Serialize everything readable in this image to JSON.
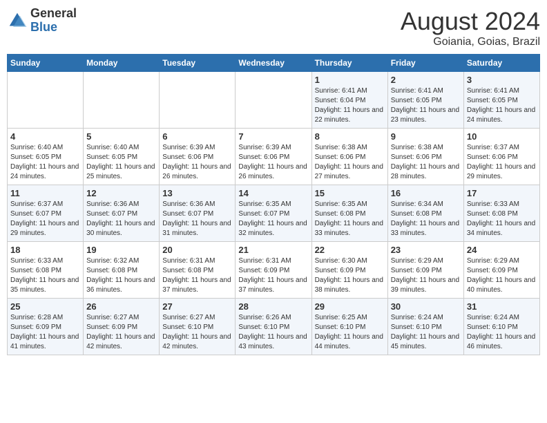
{
  "header": {
    "logo_general": "General",
    "logo_blue": "Blue",
    "month_year": "August 2024",
    "location": "Goiania, Goias, Brazil"
  },
  "days_of_week": [
    "Sunday",
    "Monday",
    "Tuesday",
    "Wednesday",
    "Thursday",
    "Friday",
    "Saturday"
  ],
  "weeks": [
    [
      {
        "day": "",
        "text": ""
      },
      {
        "day": "",
        "text": ""
      },
      {
        "day": "",
        "text": ""
      },
      {
        "day": "",
        "text": ""
      },
      {
        "day": "1",
        "text": "Sunrise: 6:41 AM\nSunset: 6:04 PM\nDaylight: 11 hours and 22 minutes."
      },
      {
        "day": "2",
        "text": "Sunrise: 6:41 AM\nSunset: 6:05 PM\nDaylight: 11 hours and 23 minutes."
      },
      {
        "day": "3",
        "text": "Sunrise: 6:41 AM\nSunset: 6:05 PM\nDaylight: 11 hours and 24 minutes."
      }
    ],
    [
      {
        "day": "4",
        "text": "Sunrise: 6:40 AM\nSunset: 6:05 PM\nDaylight: 11 hours and 24 minutes."
      },
      {
        "day": "5",
        "text": "Sunrise: 6:40 AM\nSunset: 6:05 PM\nDaylight: 11 hours and 25 minutes."
      },
      {
        "day": "6",
        "text": "Sunrise: 6:39 AM\nSunset: 6:06 PM\nDaylight: 11 hours and 26 minutes."
      },
      {
        "day": "7",
        "text": "Sunrise: 6:39 AM\nSunset: 6:06 PM\nDaylight: 11 hours and 26 minutes."
      },
      {
        "day": "8",
        "text": "Sunrise: 6:38 AM\nSunset: 6:06 PM\nDaylight: 11 hours and 27 minutes."
      },
      {
        "day": "9",
        "text": "Sunrise: 6:38 AM\nSunset: 6:06 PM\nDaylight: 11 hours and 28 minutes."
      },
      {
        "day": "10",
        "text": "Sunrise: 6:37 AM\nSunset: 6:06 PM\nDaylight: 11 hours and 29 minutes."
      }
    ],
    [
      {
        "day": "11",
        "text": "Sunrise: 6:37 AM\nSunset: 6:07 PM\nDaylight: 11 hours and 29 minutes."
      },
      {
        "day": "12",
        "text": "Sunrise: 6:36 AM\nSunset: 6:07 PM\nDaylight: 11 hours and 30 minutes."
      },
      {
        "day": "13",
        "text": "Sunrise: 6:36 AM\nSunset: 6:07 PM\nDaylight: 11 hours and 31 minutes."
      },
      {
        "day": "14",
        "text": "Sunrise: 6:35 AM\nSunset: 6:07 PM\nDaylight: 11 hours and 32 minutes."
      },
      {
        "day": "15",
        "text": "Sunrise: 6:35 AM\nSunset: 6:08 PM\nDaylight: 11 hours and 33 minutes."
      },
      {
        "day": "16",
        "text": "Sunrise: 6:34 AM\nSunset: 6:08 PM\nDaylight: 11 hours and 33 minutes."
      },
      {
        "day": "17",
        "text": "Sunrise: 6:33 AM\nSunset: 6:08 PM\nDaylight: 11 hours and 34 minutes."
      }
    ],
    [
      {
        "day": "18",
        "text": "Sunrise: 6:33 AM\nSunset: 6:08 PM\nDaylight: 11 hours and 35 minutes."
      },
      {
        "day": "19",
        "text": "Sunrise: 6:32 AM\nSunset: 6:08 PM\nDaylight: 11 hours and 36 minutes."
      },
      {
        "day": "20",
        "text": "Sunrise: 6:31 AM\nSunset: 6:08 PM\nDaylight: 11 hours and 37 minutes."
      },
      {
        "day": "21",
        "text": "Sunrise: 6:31 AM\nSunset: 6:09 PM\nDaylight: 11 hours and 37 minutes."
      },
      {
        "day": "22",
        "text": "Sunrise: 6:30 AM\nSunset: 6:09 PM\nDaylight: 11 hours and 38 minutes."
      },
      {
        "day": "23",
        "text": "Sunrise: 6:29 AM\nSunset: 6:09 PM\nDaylight: 11 hours and 39 minutes."
      },
      {
        "day": "24",
        "text": "Sunrise: 6:29 AM\nSunset: 6:09 PM\nDaylight: 11 hours and 40 minutes."
      }
    ],
    [
      {
        "day": "25",
        "text": "Sunrise: 6:28 AM\nSunset: 6:09 PM\nDaylight: 11 hours and 41 minutes."
      },
      {
        "day": "26",
        "text": "Sunrise: 6:27 AM\nSunset: 6:09 PM\nDaylight: 11 hours and 42 minutes."
      },
      {
        "day": "27",
        "text": "Sunrise: 6:27 AM\nSunset: 6:10 PM\nDaylight: 11 hours and 42 minutes."
      },
      {
        "day": "28",
        "text": "Sunrise: 6:26 AM\nSunset: 6:10 PM\nDaylight: 11 hours and 43 minutes."
      },
      {
        "day": "29",
        "text": "Sunrise: 6:25 AM\nSunset: 6:10 PM\nDaylight: 11 hours and 44 minutes."
      },
      {
        "day": "30",
        "text": "Sunrise: 6:24 AM\nSunset: 6:10 PM\nDaylight: 11 hours and 45 minutes."
      },
      {
        "day": "31",
        "text": "Sunrise: 6:24 AM\nSunset: 6:10 PM\nDaylight: 11 hours and 46 minutes."
      }
    ]
  ]
}
